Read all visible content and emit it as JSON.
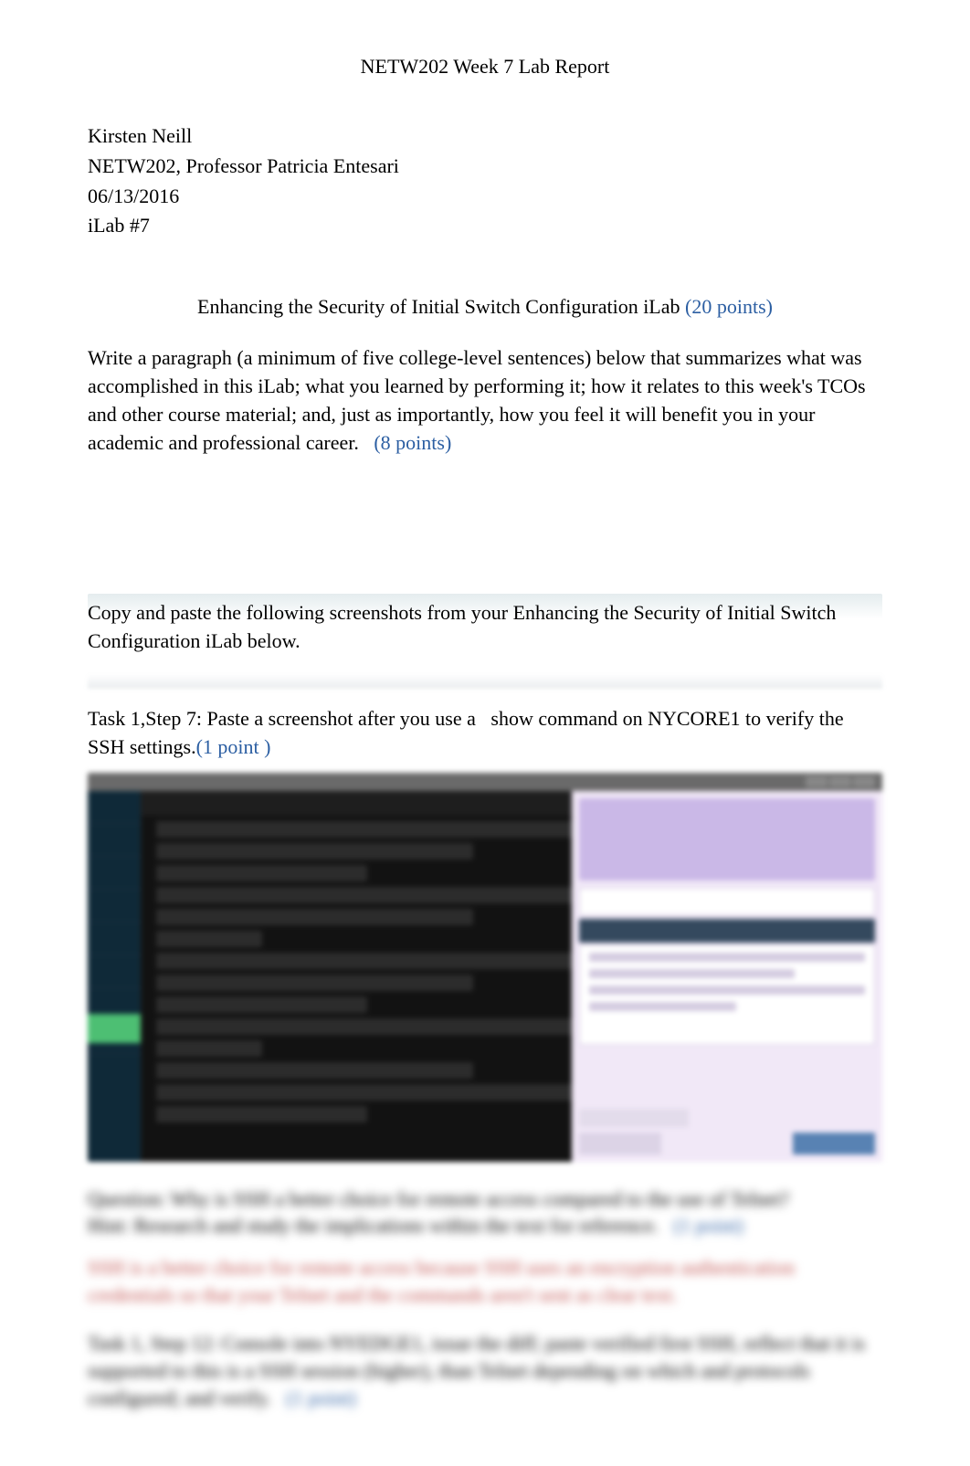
{
  "header": {
    "title": "NETW202 Week 7 Lab Report"
  },
  "student": {
    "name": "Kirsten Neill",
    "course_line": "NETW202, Professor Patricia Entesari",
    "date": "06/13/2016",
    "lab": "iLab #7"
  },
  "lab_section": {
    "title": "Enhancing the Security of Initial Switch Configuration iLab",
    "total_points": "(20 points)",
    "paragraph_prompt": "Write a paragraph (a minimum of five college-level sentences) below that summarizes what was accomplished in this iLab; what you learned by performing it; how it relates to this week's TCOs and other course material; and, just as importantly, how you feel it will benefit you in your academic and professional career.",
    "paragraph_points": "(8 points)"
  },
  "instructions": {
    "copy_paste": "Copy and paste the following screenshots from your Enhancing the Security of Initial Switch Configuration iLab below",
    "task1_step7_a": "Task 1,Step 7: Paste a screenshot after you use a",
    "task1_step7_b": "show command on NYCORE1 to verify the SSH settings",
    "task1_step7_points": "(1 point )"
  },
  "blurred": {
    "q1_line1": "Question: Why is SSH a better choice for remote access compared to the use of Telnet?",
    "q1_line2": "Hint: Research and study the implications within the text for reference.",
    "q1_points": "(1 point)",
    "q1_answer": "SSH is a better choice for remote access because SSH uses an encryption authentication credentials so that your Telnet and the commands aren't sent as clear text.",
    "task1_step12": "Task 1, Step 12: Console into NYEDGE1, issue the diff; paste verified first SSH, reflect that it is supported to this is a SSH session (higher), than Telnet depending on which and protocols configured; and verify.",
    "task1_step12_points": "(1 point)"
  }
}
